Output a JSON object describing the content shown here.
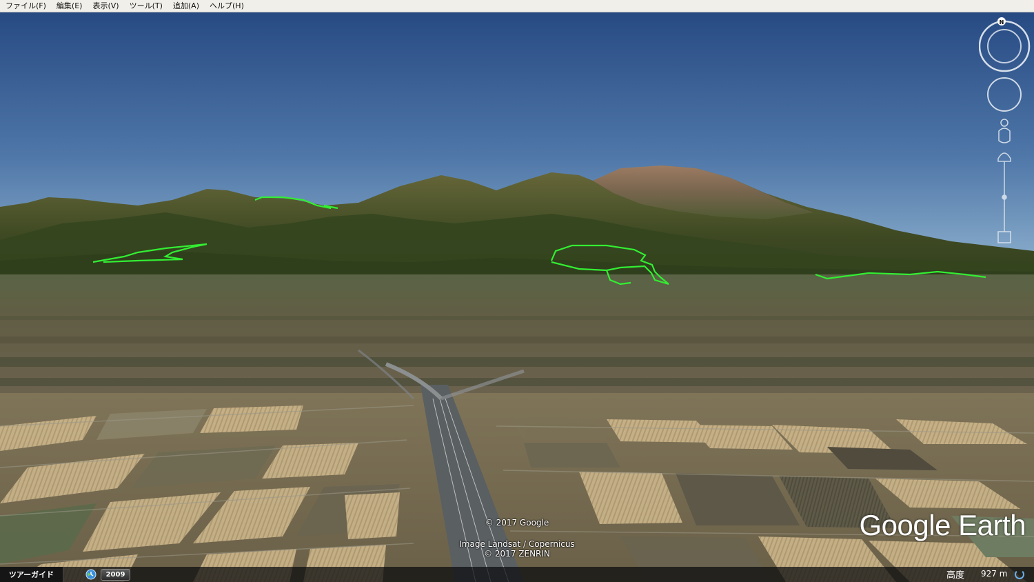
{
  "menu": [
    {
      "label": "ファイル(F)"
    },
    {
      "label": "編集(E)"
    },
    {
      "label": "表示(V)"
    },
    {
      "label": "ツール(T)"
    },
    {
      "label": "追加(A)"
    },
    {
      "label": "ヘルプ(H)"
    }
  ],
  "compass": {
    "north_label": "N"
  },
  "credits": {
    "line1": "© 2017 Google",
    "line2": "Image Landsat / Copernicus",
    "line3": "© 2017 ZENRIN"
  },
  "brand": "Google Earth",
  "status": {
    "tour_guide": "ツアーガイド",
    "year": "2009",
    "altitude_label": "高度",
    "altitude_value": "927 m"
  },
  "colors": {
    "sky_top": "#2a4d86",
    "sky_bottom": "#87aac9",
    "outline_accent": "#33ee33",
    "fields": "#8a7a55"
  },
  "icons": {
    "compass": "compass-ring-icon",
    "look": "look-joystick-icon",
    "street_view": "pegman-icon",
    "zoom": "zoom-slider-icon",
    "history": "clock-history-icon",
    "loading": "loading-spinner-icon"
  }
}
